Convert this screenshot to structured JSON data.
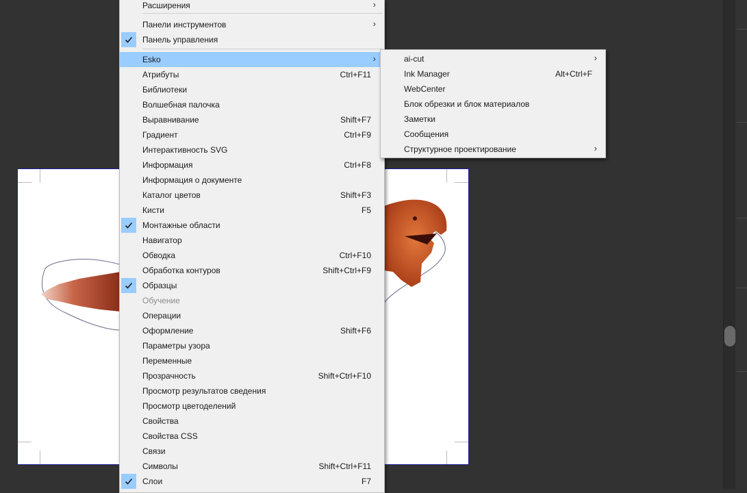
{
  "main_menu": {
    "items": [
      {
        "label": "Расширения",
        "shortcut": "",
        "submenu": true,
        "checked": false,
        "disabled": false,
        "highlighted": false
      },
      {
        "label": "Панели инструментов",
        "shortcut": "",
        "submenu": true,
        "checked": false,
        "disabled": false,
        "highlighted": false
      },
      {
        "label": "Панель управления",
        "shortcut": "",
        "submenu": false,
        "checked": true,
        "disabled": false,
        "highlighted": false
      },
      {
        "label": "Esko",
        "shortcut": "",
        "submenu": true,
        "checked": false,
        "disabled": false,
        "highlighted": true
      },
      {
        "label": "Атрибуты",
        "shortcut": "Ctrl+F11",
        "submenu": false,
        "checked": false,
        "disabled": false,
        "highlighted": false
      },
      {
        "label": "Библиотеки",
        "shortcut": "",
        "submenu": false,
        "checked": false,
        "disabled": false,
        "highlighted": false
      },
      {
        "label": "Волшебная палочка",
        "shortcut": "",
        "submenu": false,
        "checked": false,
        "disabled": false,
        "highlighted": false
      },
      {
        "label": "Выравнивание",
        "shortcut": "Shift+F7",
        "submenu": false,
        "checked": false,
        "disabled": false,
        "highlighted": false
      },
      {
        "label": "Градиент",
        "shortcut": "Ctrl+F9",
        "submenu": false,
        "checked": false,
        "disabled": false,
        "highlighted": false
      },
      {
        "label": "Интерактивность SVG",
        "shortcut": "",
        "submenu": false,
        "checked": false,
        "disabled": false,
        "highlighted": false
      },
      {
        "label": "Информация",
        "shortcut": "Ctrl+F8",
        "submenu": false,
        "checked": false,
        "disabled": false,
        "highlighted": false
      },
      {
        "label": "Информация о документе",
        "shortcut": "",
        "submenu": false,
        "checked": false,
        "disabled": false,
        "highlighted": false
      },
      {
        "label": "Каталог цветов",
        "shortcut": "Shift+F3",
        "submenu": false,
        "checked": false,
        "disabled": false,
        "highlighted": false
      },
      {
        "label": "Кисти",
        "shortcut": "F5",
        "submenu": false,
        "checked": false,
        "disabled": false,
        "highlighted": false
      },
      {
        "label": "Монтажные области",
        "shortcut": "",
        "submenu": false,
        "checked": true,
        "disabled": false,
        "highlighted": false
      },
      {
        "label": "Навигатор",
        "shortcut": "",
        "submenu": false,
        "checked": false,
        "disabled": false,
        "highlighted": false
      },
      {
        "label": "Обводка",
        "shortcut": "Ctrl+F10",
        "submenu": false,
        "checked": false,
        "disabled": false,
        "highlighted": false
      },
      {
        "label": "Обработка контуров",
        "shortcut": "Shift+Ctrl+F9",
        "submenu": false,
        "checked": false,
        "disabled": false,
        "highlighted": false
      },
      {
        "label": "Образцы",
        "shortcut": "",
        "submenu": false,
        "checked": true,
        "disabled": false,
        "highlighted": false
      },
      {
        "label": "Обучение",
        "shortcut": "",
        "submenu": false,
        "checked": false,
        "disabled": true,
        "highlighted": false
      },
      {
        "label": "Операции",
        "shortcut": "",
        "submenu": false,
        "checked": false,
        "disabled": false,
        "highlighted": false
      },
      {
        "label": "Оформление",
        "shortcut": "Shift+F6",
        "submenu": false,
        "checked": false,
        "disabled": false,
        "highlighted": false
      },
      {
        "label": "Параметры узора",
        "shortcut": "",
        "submenu": false,
        "checked": false,
        "disabled": false,
        "highlighted": false
      },
      {
        "label": "Переменные",
        "shortcut": "",
        "submenu": false,
        "checked": false,
        "disabled": false,
        "highlighted": false
      },
      {
        "label": "Прозрачность",
        "shortcut": "Shift+Ctrl+F10",
        "submenu": false,
        "checked": false,
        "disabled": false,
        "highlighted": false
      },
      {
        "label": "Просмотр результатов сведения",
        "shortcut": "",
        "submenu": false,
        "checked": false,
        "disabled": false,
        "highlighted": false
      },
      {
        "label": "Просмотр цветоделений",
        "shortcut": "",
        "submenu": false,
        "checked": false,
        "disabled": false,
        "highlighted": false
      },
      {
        "label": "Свойства",
        "shortcut": "",
        "submenu": false,
        "checked": false,
        "disabled": false,
        "highlighted": false
      },
      {
        "label": "Свойства CSS",
        "shortcut": "",
        "submenu": false,
        "checked": false,
        "disabled": false,
        "highlighted": false
      },
      {
        "label": "Связи",
        "shortcut": "",
        "submenu": false,
        "checked": false,
        "disabled": false,
        "highlighted": false
      },
      {
        "label": "Символы",
        "shortcut": "Shift+Ctrl+F11",
        "submenu": false,
        "checked": false,
        "disabled": false,
        "highlighted": false
      },
      {
        "label": "Слои",
        "shortcut": "F7",
        "submenu": false,
        "checked": true,
        "disabled": false,
        "highlighted": false
      }
    ]
  },
  "esko_submenu": {
    "items": [
      {
        "label": "ai-cut",
        "shortcut": "",
        "submenu": true
      },
      {
        "label": "Ink Manager",
        "shortcut": "Alt+Ctrl+F",
        "submenu": false
      },
      {
        "label": "WebCenter",
        "shortcut": "",
        "submenu": false
      },
      {
        "label": "Блок обрезки и блок материалов",
        "shortcut": "",
        "submenu": false
      },
      {
        "label": "Заметки",
        "shortcut": "",
        "submenu": false
      },
      {
        "label": "Сообщения",
        "shortcut": "",
        "submenu": false
      },
      {
        "label": "Структурное проектирование",
        "shortcut": "",
        "submenu": true
      }
    ]
  },
  "icons": {
    "check": "checkmark-icon",
    "submenu": "chevron-right-icon"
  },
  "colors": {
    "highlight": "#99ccff",
    "menu_bg": "#f0f0f0",
    "canvas_bg": "#323232",
    "artboard_border": "#1a1a9a"
  }
}
